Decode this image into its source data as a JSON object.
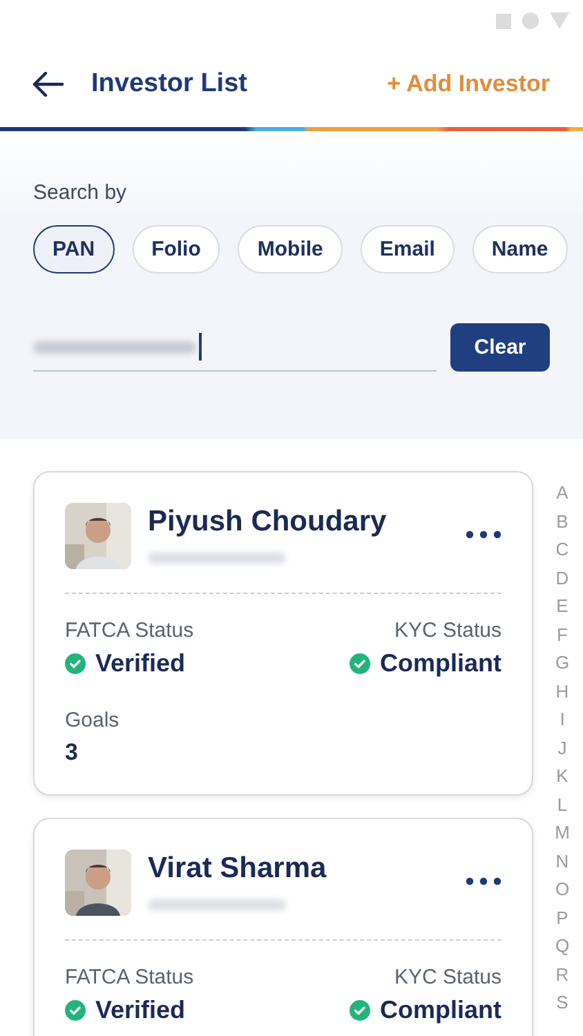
{
  "header": {
    "title": "Investor List",
    "action": "+ Add Investor"
  },
  "search": {
    "label": "Search by",
    "options": [
      {
        "label": "PAN",
        "selected": true
      },
      {
        "label": "Folio",
        "selected": false
      },
      {
        "label": "Mobile",
        "selected": false
      },
      {
        "label": "Email",
        "selected": false
      },
      {
        "label": "Name",
        "selected": false
      }
    ],
    "button": "Clear"
  },
  "investors": [
    {
      "name": "Piyush Choudary",
      "fatca_label": "FATCA Status",
      "fatca": "Verified",
      "kyc_label": "KYC Status",
      "kyc": "Compliant",
      "goals_label": "Goals",
      "goals": "3"
    },
    {
      "name": "Virat Sharma",
      "fatca_label": "FATCA Status",
      "fatca": "Verified",
      "kyc_label": "KYC Status",
      "kyc": "Compliant"
    }
  ],
  "alphabet": [
    "A",
    "B",
    "C",
    "D",
    "E",
    "F",
    "G",
    "H",
    "I",
    "J",
    "K",
    "L",
    "M",
    "N",
    "O",
    "P",
    "Q",
    "R",
    "S"
  ]
}
